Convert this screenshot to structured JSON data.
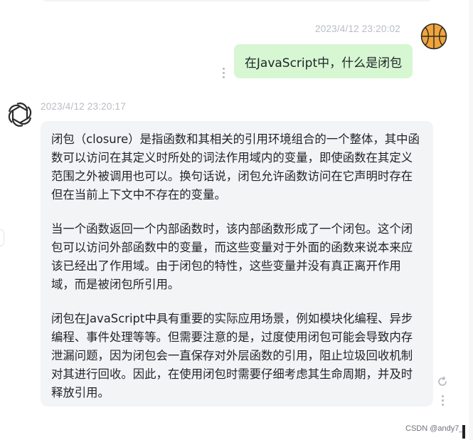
{
  "messages": {
    "user": {
      "timestamp": "2023/4/12 23:20:02",
      "text": "在JavaScript中，什么是闭包",
      "avatar_icon": "basketball-icon"
    },
    "assistant": {
      "timestamp": "2023/4/12 23:20:17",
      "avatar_icon": "openai-logo-icon",
      "paragraphs": [
        "闭包（closure）是指函数和其相关的引用环境组合的一个整体，其中函数可以访问在其定义时所处的词法作用域内的变量，即使函数在其定义范围之外被调用也可以。换句话说，闭包允许函数访问在它声明时存在但在当前上下文中不存在的变量。",
        "当一个函数返回一个内部函数时，该内部函数形成了一个闭包。这个闭包可以访问外部函数中的变量，而这些变量对于外面的函数来说本来应该已经出了作用域。由于闭包的特性，这些变量并没有真正离开作用域，而是被闭包所引用。",
        "闭包在JavaScript中具有重要的实际应用场景，例如模块化编程、异步编程、事件处理等等。但需要注意的是，过度使用闭包可能会导致内存泄漏问题，因为闭包会一直保存对外层函数的引用，阻止垃圾回收机制对其进行回收。因此，在使用闭包时需要仔细考虑其生命周期，并及时释放引用。"
      ]
    }
  },
  "watermark": "CSDN @andy7_",
  "colors": {
    "user_bubble": "#d6f7d2",
    "assistant_bubble": "#f3f4f6",
    "timestamp": "#b8bcc3",
    "basketball": "#f0a43a"
  }
}
